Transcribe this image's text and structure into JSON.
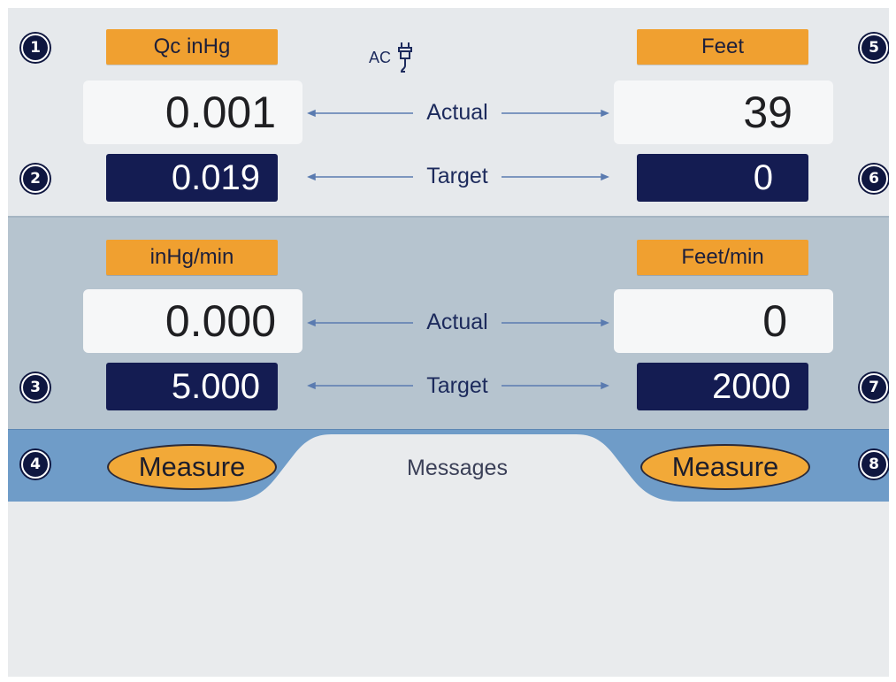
{
  "power": {
    "label": "AC",
    "icon": "plug-icon"
  },
  "badges": [
    "1",
    "2",
    "3",
    "4",
    "5",
    "6",
    "7",
    "8"
  ],
  "row_labels": {
    "actual": "Actual",
    "target": "Target"
  },
  "pressure": {
    "unit": "Qc inHg",
    "actual": "0.001",
    "target": "0.019",
    "rate_unit": "inHg/min",
    "rate_actual": "0.000",
    "rate_target": "5.000"
  },
  "altitude": {
    "unit": "Feet",
    "actual": "39",
    "target": "0",
    "rate_unit": "Feet/min",
    "rate_actual": "0",
    "rate_target": "2000"
  },
  "buttons": {
    "measure_left": "Measure",
    "measure_right": "Measure"
  },
  "messages_tab": "Messages",
  "colors": {
    "accent_orange": "#f0a030",
    "target_navy": "#141c52",
    "mid_band": "#b6c4cf",
    "message_bar": "#6f9cc8"
  }
}
